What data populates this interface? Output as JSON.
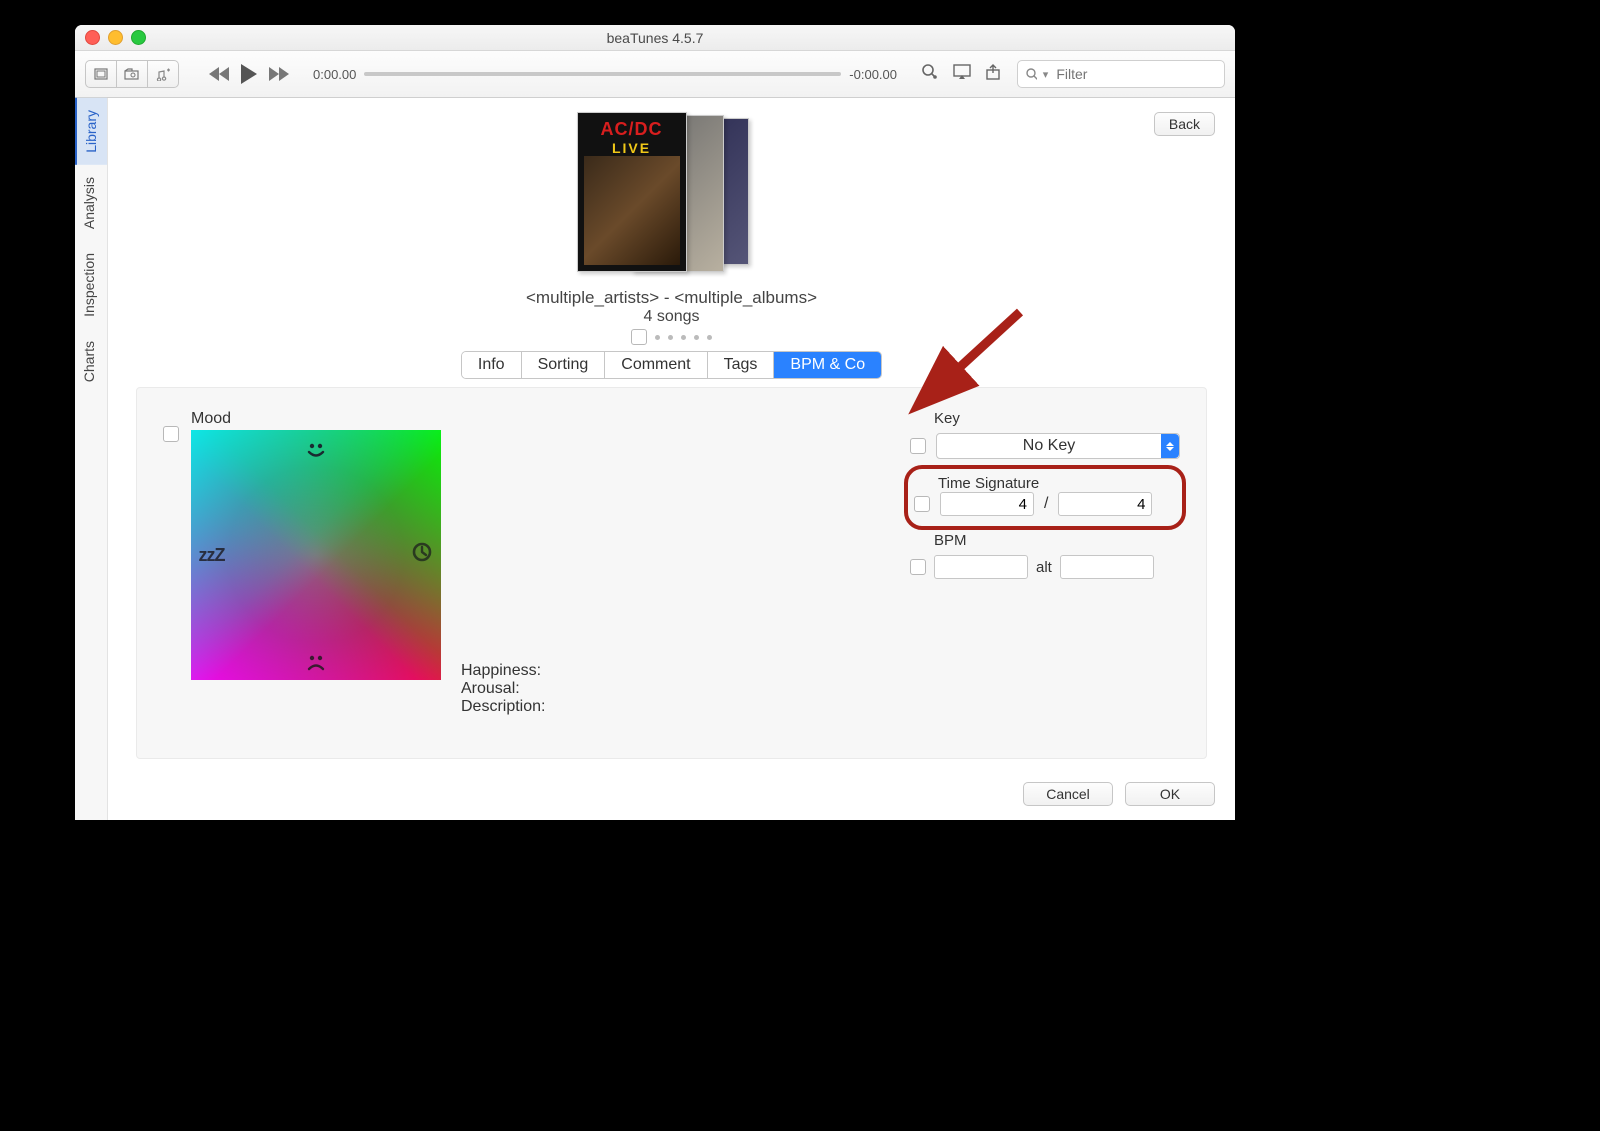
{
  "window": {
    "title": "beaTunes 4.5.7"
  },
  "toolbar": {
    "time_elapsed": "0:00.00",
    "time_remaining": "-0:00.00",
    "search_placeholder": "Filter"
  },
  "sidebar": {
    "items": [
      {
        "label": "Library"
      },
      {
        "label": "Analysis"
      },
      {
        "label": "Inspection"
      },
      {
        "label": "Charts"
      }
    ]
  },
  "back_label": "Back",
  "album": {
    "artist_line": "<multiple_artists> - <multiple_albums>",
    "songs_line": "4 songs",
    "cover_logo": "AC/DC",
    "cover_sub": "LIVE"
  },
  "tabs": [
    {
      "label": "Info"
    },
    {
      "label": "Sorting"
    },
    {
      "label": "Comment"
    },
    {
      "label": "Tags"
    },
    {
      "label": "BPM & Co"
    }
  ],
  "panel": {
    "mood_label": "Mood",
    "mood_zzz": "zzZ",
    "mood_top": "😐",
    "mood_bottom": "☹",
    "mood_right": "◔",
    "happiness_label": "Happiness:",
    "arousal_label": "Arousal:",
    "description_label": "Description:",
    "key_label": "Key",
    "key_value": "No Key",
    "timesig_label": "Time Signature",
    "timesig_num": "4",
    "timesig_den": "4",
    "timesig_sep": "/",
    "bpm_label": "BPM",
    "bpm_value": "",
    "bpm_alt_label": "alt",
    "bpm_alt_value": ""
  },
  "footer": {
    "cancel": "Cancel",
    "ok": "OK"
  }
}
